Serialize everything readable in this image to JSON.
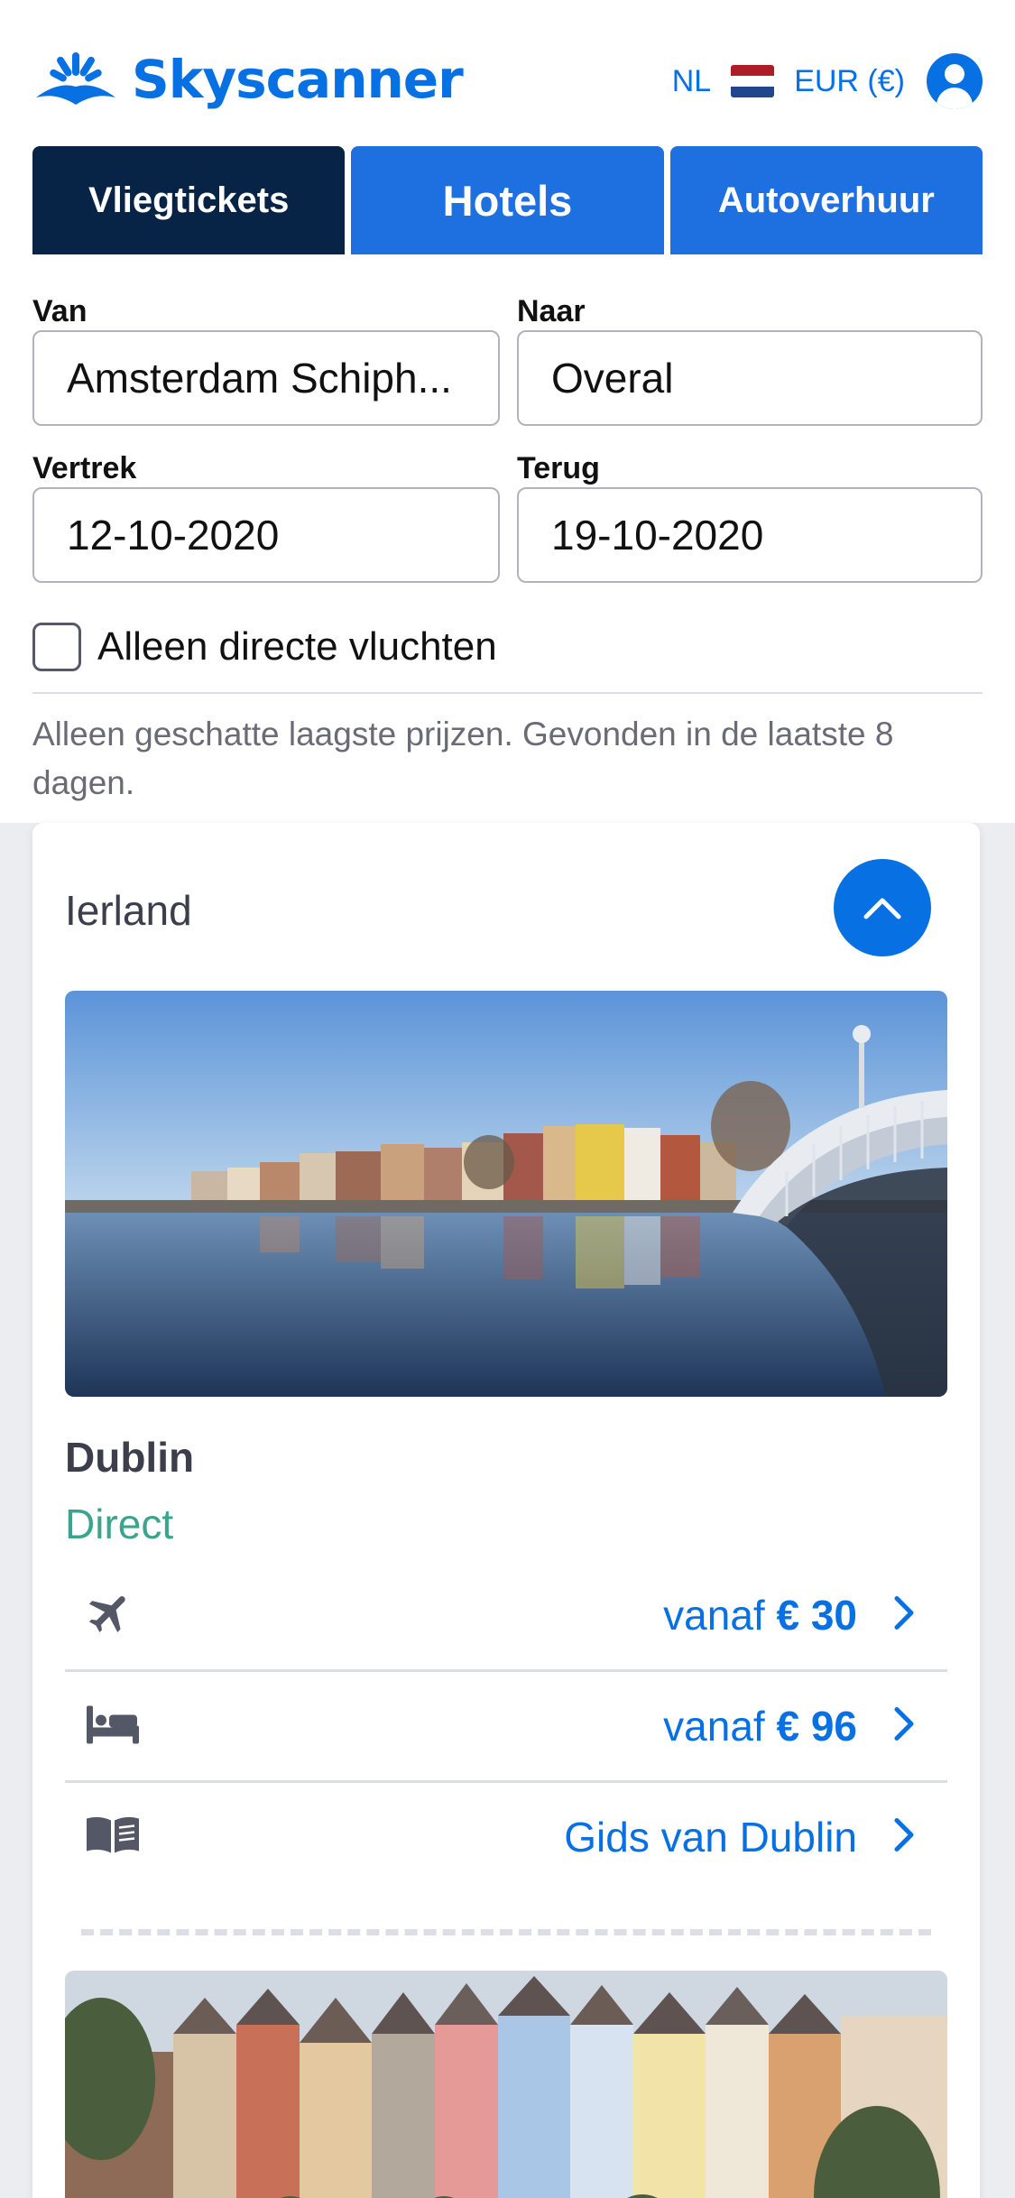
{
  "header": {
    "logo_text": "Skyscanner",
    "language": "NL",
    "currency": "EUR (€)",
    "flag_colors": [
      "#ae1c28",
      "#ffffff",
      "#21468b"
    ],
    "brand_color": "#0770e3"
  },
  "tabs": [
    {
      "label": "Vliegtickets",
      "active": true
    },
    {
      "label": "Hotels",
      "active": false
    },
    {
      "label": "Autoverhuur",
      "active": false
    }
  ],
  "search": {
    "from": {
      "label": "Van",
      "value": "Amsterdam Schiph..."
    },
    "to": {
      "label": "Naar",
      "value": "Overal"
    },
    "depart": {
      "label": "Vertrek",
      "value": "12-10-2020"
    },
    "return": {
      "label": "Terug",
      "value": "19-10-2020"
    },
    "direct_only": {
      "label": "Alleen directe vluchten",
      "checked": false
    }
  },
  "disclaimer": "Alleen geschatte laagste prijzen. Gevonden in de laatste 8 dagen.",
  "result": {
    "country": "Ierland",
    "expanded": true,
    "city": "Dublin",
    "flight_type": "Direct",
    "flight": {
      "prefix": "vanaf",
      "price": "€ 30",
      "icon": "airplane-icon"
    },
    "hotel": {
      "prefix": "vanaf",
      "price": "€ 96",
      "icon": "bed-icon"
    },
    "guide": {
      "label": "Gids van Dublin",
      "icon": "book-icon"
    }
  }
}
